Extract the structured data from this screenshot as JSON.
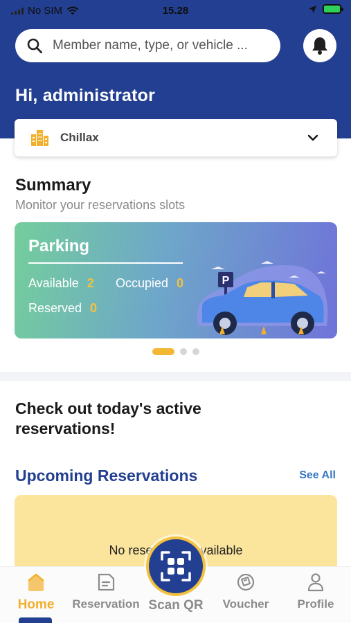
{
  "status_bar": {
    "carrier": "No SIM",
    "time": "15.28"
  },
  "header": {
    "search_placeholder": "Member name, type, or vehicle ...",
    "greeting": "Hi, administrator",
    "location": "Chillax"
  },
  "summary": {
    "title": "Summary",
    "subtitle": "Monitor your reservations slots",
    "card": {
      "title": "Parking",
      "available_label": "Available",
      "available_value": "2",
      "occupied_label": "Occupied",
      "occupied_value": "0",
      "reserved_label": "Reserved",
      "reserved_value": "0",
      "parking_sign": "P"
    },
    "carousel_pages": 3,
    "carousel_active": 0
  },
  "active_heading": "Check out today's active reservations!",
  "upcoming": {
    "title": "Upcoming Reservations",
    "see_all": "See All",
    "empty_text": "No reservation available"
  },
  "bottom_nav": {
    "items": [
      {
        "label": "Home",
        "icon": "home-icon",
        "active": true
      },
      {
        "label": "Reservation",
        "icon": "reservation-icon",
        "active": false
      },
      {
        "label": "Scan QR",
        "icon": "scan-qr-icon",
        "active": false
      },
      {
        "label": "Voucher",
        "icon": "voucher-icon",
        "active": false
      },
      {
        "label": "Profile",
        "icon": "profile-icon",
        "active": false
      }
    ]
  },
  "colors": {
    "brand_blue": "#233f91",
    "accent_yellow": "#f4c13e",
    "empty_card_bg": "#fbe49c",
    "link_blue": "#3a78c4"
  }
}
